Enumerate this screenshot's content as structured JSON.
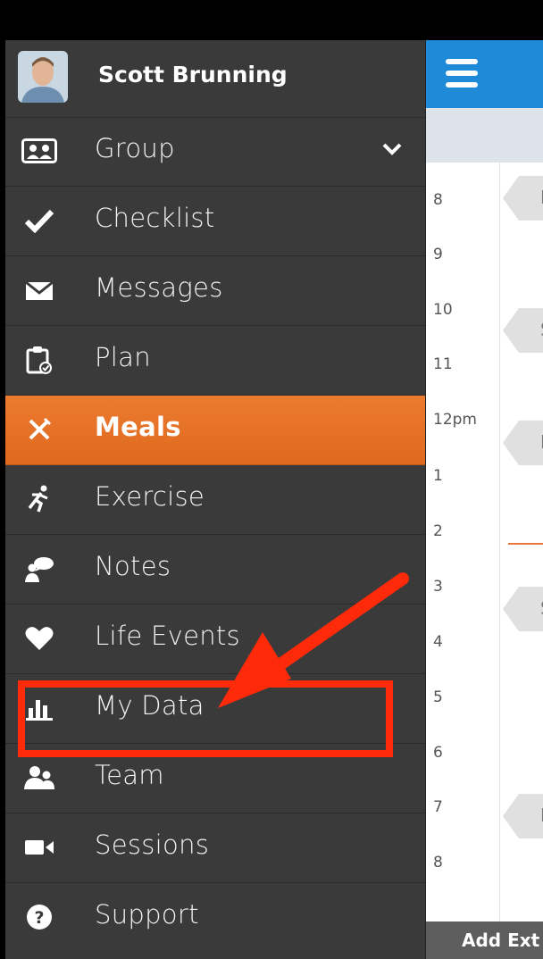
{
  "profile": {
    "name": "Scott Brunning"
  },
  "nav": [
    {
      "label": "Group",
      "icon": "group-icon"
    },
    {
      "label": "Checklist",
      "icon": "checkmark-icon"
    },
    {
      "label": "Messages",
      "icon": "envelope-icon"
    },
    {
      "label": "Plan",
      "icon": "clipboard-icon"
    },
    {
      "label": "Meals",
      "icon": "fork-knife-icon",
      "active": true
    },
    {
      "label": "Exercise",
      "icon": "running-icon"
    },
    {
      "label": "Notes",
      "icon": "notes-icon"
    },
    {
      "label": "Life Events",
      "icon": "heart-icon"
    },
    {
      "label": "My Data",
      "icon": "bar-chart-icon"
    },
    {
      "label": "Team",
      "icon": "team-icon"
    },
    {
      "label": "Sessions",
      "icon": "video-camera-icon"
    },
    {
      "label": "Support",
      "icon": "help-icon"
    }
  ],
  "timeline": {
    "hours": [
      "8",
      "9",
      "10",
      "11",
      "12pm",
      "1",
      "2",
      "3",
      "4",
      "5",
      "6",
      "7",
      "8"
    ],
    "meal_tags": [
      "B",
      "S",
      "L",
      "S",
      "D"
    ]
  },
  "bottom_bar": {
    "label": "Add Ext"
  },
  "colors": {
    "accent_orange": "#e8732a",
    "topbar_blue": "#1f8ad8",
    "annotation_red": "#ff2a0a",
    "drawer_bg": "#3a3a3a"
  }
}
